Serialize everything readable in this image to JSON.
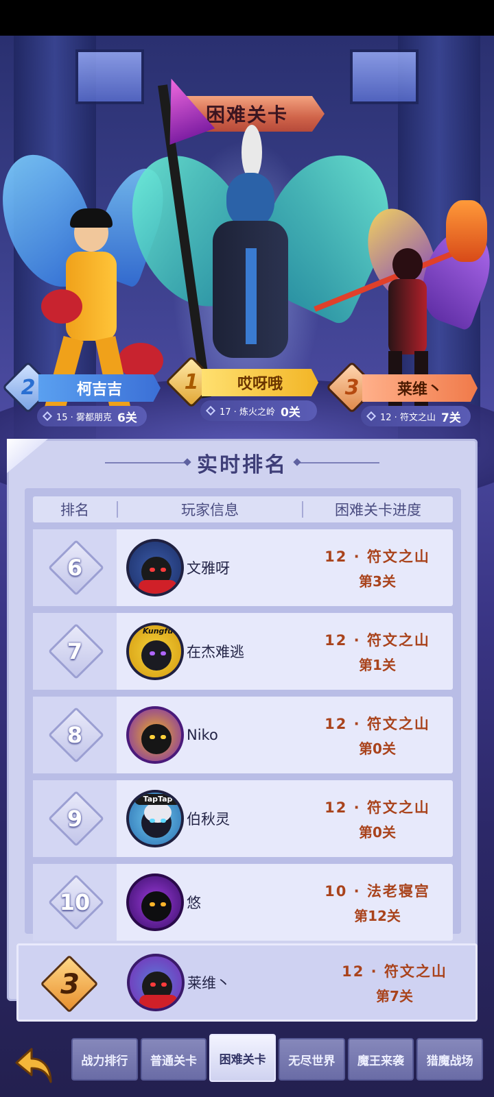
{
  "title": "困难关卡",
  "podium": [
    {
      "rank": "2",
      "name": "柯吉吉",
      "stage": "15 · 雾都朋克",
      "level": "6关"
    },
    {
      "rank": "1",
      "name": "哎呀哦",
      "stage": "17 · 炼火之岭",
      "level": "0关"
    },
    {
      "rank": "3",
      "name": "莱维丶",
      "stage": "12 · 符文之山",
      "level": "7关"
    }
  ],
  "panel": {
    "title": "实时排名",
    "headers": {
      "rank": "排名",
      "player": "玩家信息",
      "progress": "困难关卡进度"
    }
  },
  "rows": [
    {
      "rank": "6",
      "name": "文雅呀",
      "stage": "12 · 符文之山",
      "level": "第3关"
    },
    {
      "rank": "7",
      "name": "在杰难逃",
      "stage": "12 · 符文之山",
      "level": "第1关"
    },
    {
      "rank": "8",
      "name": "Niko",
      "stage": "12 · 符文之山",
      "level": "第0关"
    },
    {
      "rank": "9",
      "name": "伯秋灵",
      "stage": "12 · 符文之山",
      "level": "第0关"
    },
    {
      "rank": "10",
      "name": "悠",
      "stage": "10 · 法老寝宫",
      "level": "第12关"
    }
  ],
  "my_row": {
    "rank": "3",
    "name": "莱维丶",
    "stage": "12 · 符文之山",
    "level": "第7关"
  },
  "tabs": [
    "战力排行",
    "普通关卡",
    "困难关卡",
    "无尽世界",
    "魔王来袭",
    "猎魔战场"
  ],
  "active_tab": "困难关卡",
  "avatar_badges": {
    "row_7": "Kungfu",
    "row_9": "TapTap"
  }
}
